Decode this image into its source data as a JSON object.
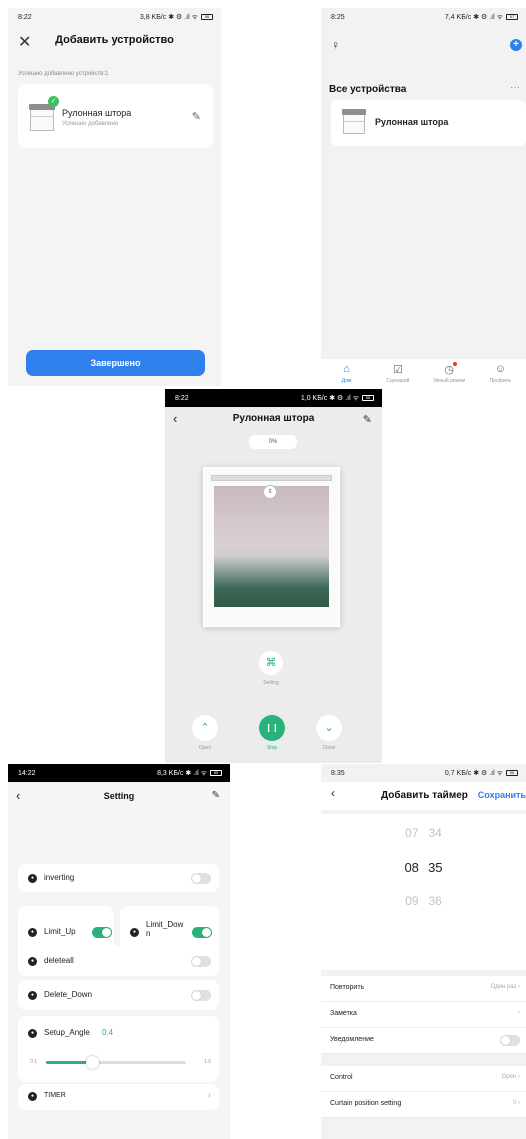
{
  "screen_add": {
    "status": {
      "time": "8:22",
      "right": "3,8 KБ/с ✱ ⚙ .ıl ᯤ",
      "battery": "56"
    },
    "title": "Добавить устройство",
    "note": "Успешно добавлено устройств:1",
    "device": {
      "name": "Рулонная штора",
      "status": "Успешно добавлено"
    },
    "done_label": "Завершено",
    "accent": "#2f80ed"
  },
  "screen_home": {
    "status": {
      "time": "8:25",
      "right": "7,4 KБ/с ✱ ⚙ .ıl ᯤ",
      "battery": "57"
    },
    "heading": "Все устройства",
    "more": "···",
    "device_name": "Рулонная штора",
    "tabs": [
      {
        "label": "Дом",
        "icon": "home-icon"
      },
      {
        "label": "Сценарий",
        "icon": "scenario-icon"
      },
      {
        "label": "Умный режим",
        "icon": "smart-icon"
      },
      {
        "label": "Профиль",
        "icon": "profile-icon"
      }
    ]
  },
  "screen_curtain": {
    "status": {
      "time": "8:22",
      "right": "1,0 KБ/с ✱ ⚙ .ıl ᯤ",
      "battery": "56"
    },
    "title": "Рулонная штора",
    "percent": "0%",
    "setting_label": "Setting",
    "controls": {
      "open": "Open",
      "stop": "Stop",
      "close": "Close"
    },
    "accent": "#2ab27b"
  },
  "screen_setting": {
    "status": {
      "time": "14:22",
      "right": "8,3 KБ/с ✱ .ıl ᯤ",
      "battery": "85"
    },
    "title": "Setting",
    "rows": {
      "inverting": {
        "label": "inverting",
        "on": false
      },
      "limit_up": {
        "label": "Limit_Up",
        "on": true
      },
      "limit_down": {
        "label": "Limit_Down",
        "on": true
      },
      "deleteall": {
        "label": "deleteall",
        "on": false
      },
      "delete_down": {
        "label": "Delete_Down",
        "on": false
      }
    },
    "angle": {
      "label": "Setup_Angle",
      "value": "0.4",
      "min": "0.1",
      "max": "1.0",
      "fraction": 0.33
    },
    "timer_label": "TIMER"
  },
  "screen_timer": {
    "status": {
      "time": "8:35",
      "right": "0,7 KБ/с ✱ ⚙ .ıl ᯤ",
      "battery": "56"
    },
    "title": "Добавить таймер",
    "save": "Сохранить",
    "times": [
      {
        "h": "07",
        "m": "34"
      },
      {
        "h": "08",
        "m": "35"
      },
      {
        "h": "09",
        "m": "36"
      }
    ],
    "repeat": {
      "label": "Повторить",
      "value": "Один раз"
    },
    "note_label": "Заметка",
    "notify_label": "Уведомление",
    "control": {
      "label": "Control",
      "value": "Open"
    },
    "position": {
      "label": "Curtain position setting",
      "value": "0"
    }
  }
}
